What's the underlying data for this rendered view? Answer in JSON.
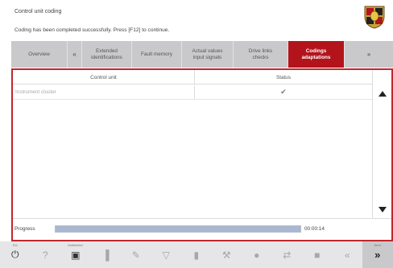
{
  "header": {
    "title": "Control unit coding",
    "message": "Coding has been completed successfully. Press [F12] to continue."
  },
  "tabs": [
    {
      "label": "Overview"
    },
    {
      "label": "«"
    },
    {
      "label": "Extended\nidentifications"
    },
    {
      "label": "Fault memory"
    },
    {
      "label": "Actual values\ninput signals"
    },
    {
      "label": "Drive links\nchecks"
    },
    {
      "label": "Codings\nadaptations",
      "active": true
    },
    {
      "label": "»"
    }
  ],
  "table": {
    "columns": [
      "Control unit",
      "Status"
    ],
    "rows": [
      {
        "unit": "Instrument cluster",
        "status": "✔"
      }
    ]
  },
  "progress": {
    "label": "Progress",
    "percent": 100,
    "time": "00:00:14"
  },
  "footer": {
    "ext_caption": "Ext",
    "multimeter_caption": "Multimeter",
    "next_caption": "Next",
    "buttons": [
      {
        "icon": "power-icon",
        "glyph": "⏻",
        "enabled": true
      },
      {
        "icon": "help-icon",
        "glyph": "?",
        "enabled": false
      },
      {
        "icon": "multimeter-icon",
        "glyph": "▣",
        "enabled": true
      },
      {
        "icon": "chart-icon",
        "glyph": "▐",
        "enabled": false
      },
      {
        "icon": "edit-icon",
        "glyph": "✎",
        "enabled": false
      },
      {
        "icon": "filter-icon",
        "glyph": "▽",
        "enabled": false
      },
      {
        "icon": "info-icon",
        "glyph": "▮",
        "enabled": false
      },
      {
        "icon": "wrench-icon",
        "glyph": "⚒",
        "enabled": false
      },
      {
        "icon": "record-icon",
        "glyph": "●",
        "enabled": false
      },
      {
        "icon": "connect-icon",
        "glyph": "⇄",
        "enabled": false
      },
      {
        "icon": "save-icon",
        "glyph": "■",
        "enabled": false
      },
      {
        "icon": "back-icon",
        "glyph": "«",
        "enabled": false
      },
      {
        "icon": "next-icon",
        "glyph": "»",
        "enabled": true
      }
    ]
  },
  "colors": {
    "accent": "#b3141c",
    "border": "#c0272d",
    "progress": "#a9b7d1"
  }
}
